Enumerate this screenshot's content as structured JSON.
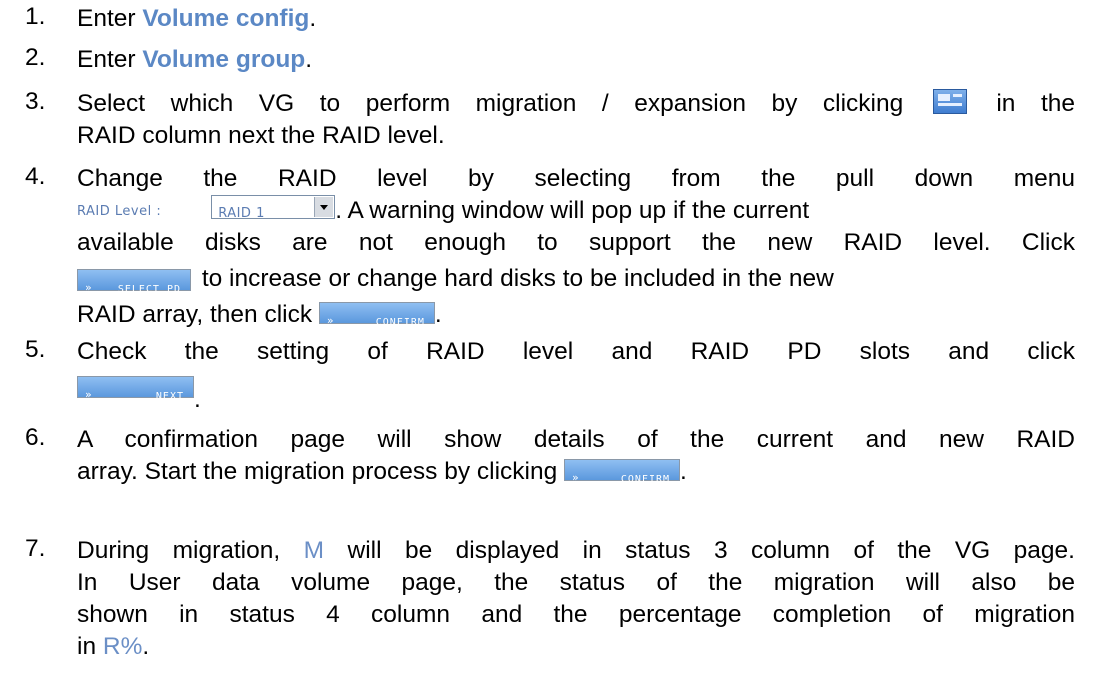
{
  "steps": [
    {
      "num": "1.",
      "prefix": "Enter ",
      "keyword": "Volume config",
      "suffix": "."
    },
    {
      "num": "2.",
      "prefix": "Enter ",
      "keyword": "Volume group",
      "suffix": "."
    },
    {
      "num": "3.",
      "line1_a": "Select which VG to perform migration / expansion by clicking",
      "line1_b": "in the",
      "line2": "RAID column next the RAID level.",
      "icon": "vg-properties-icon"
    },
    {
      "num": "4.",
      "line1": "Change the RAID level by selecting from the pull down menu",
      "raid_label": "RAID Level :",
      "raid_value": "RAID 1",
      "line2_tail": ". A warning window will pop up if the current",
      "line3": "available disks are not enough to support the new RAID level. Click",
      "select_pd_label": "SELECT PD",
      "line4_tail": "to increase or change hard disks to be included in the new",
      "line5": "RAID array, then click",
      "confirm_label": "CONFIRM",
      "end": "."
    },
    {
      "num": "5.",
      "line1": "Check the setting of RAID level and RAID PD slots and click",
      "next_label": "NEXT",
      "end": "."
    },
    {
      "num": "6.",
      "line1": "A confirmation page will show details of the current and new RAID",
      "line2": "array. Start the migration process by clicking",
      "confirm_label": "CONFIRM",
      "end": "."
    },
    {
      "num": "7.",
      "line1_a": "During migration,",
      "status_letter": "M",
      "line1_b": "will be displayed in status 3 column of the VG page.",
      "line2": "In User data volume page, the status of the migration will also be",
      "line3": "shown in status 4 column and the percentage completion of migration",
      "line4_a": "in",
      "percent_label": "R%",
      "line4_b": "."
    }
  ],
  "colors": {
    "keyword": "#5b88c5",
    "highlight": "#6b8fc6",
    "button": "#5b98dd"
  },
  "icons": {
    "button_chevron": "double-chevron-icon",
    "dropdown": "dropdown-arrow-icon"
  }
}
